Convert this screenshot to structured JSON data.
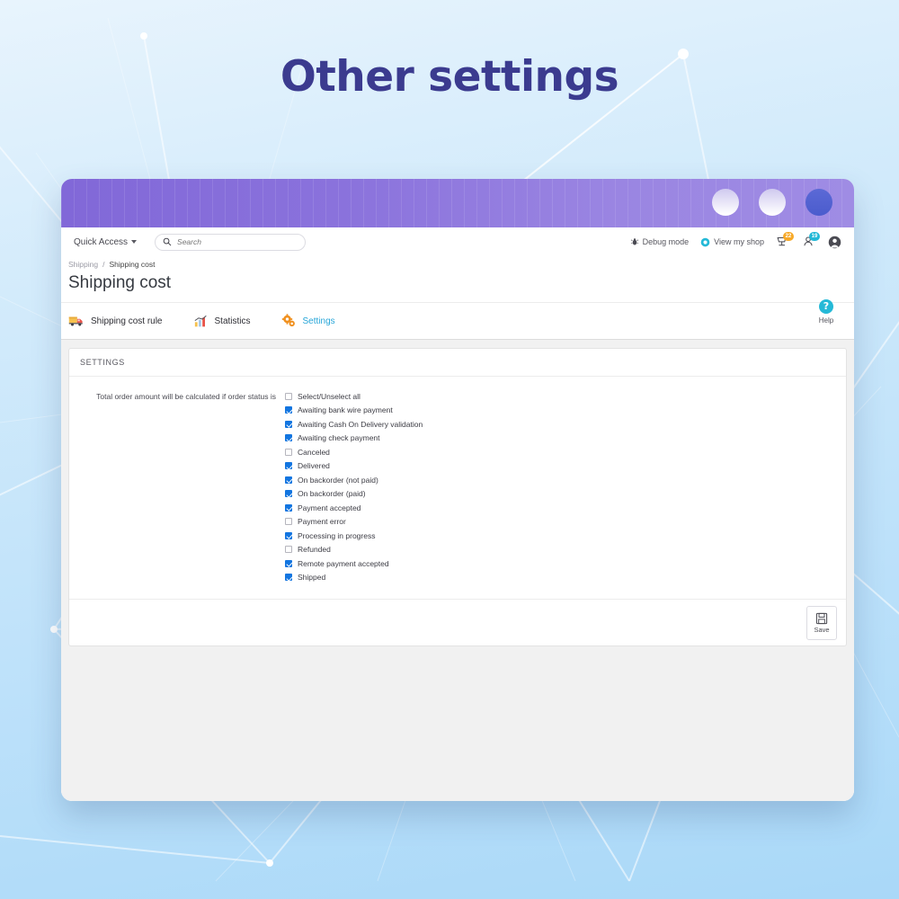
{
  "hero": {
    "title": "Other settings"
  },
  "window": {
    "controls": [
      {
        "name": "window-circle-1",
        "style": "light"
      },
      {
        "name": "window-circle-2",
        "style": "light"
      },
      {
        "name": "window-circle-3",
        "style": "dark"
      }
    ]
  },
  "header": {
    "quick_access": "Quick Access",
    "search": {
      "placeholder": "Search",
      "value": ""
    },
    "tools": [
      {
        "icon": "bug-icon",
        "label": "Debug mode"
      },
      {
        "icon": "eye-icon",
        "label": "View my shop"
      }
    ],
    "badges": [
      {
        "icon": "cart-icon",
        "count": "22",
        "color": "#f7a928"
      },
      {
        "icon": "customer-icon",
        "count": "19",
        "color": "#25b9d7"
      }
    ],
    "account": "account-icon"
  },
  "breadcrumb": {
    "parent": "Shipping",
    "separator": "/",
    "current": "Shipping cost"
  },
  "page": {
    "title": "Shipping cost"
  },
  "help": {
    "glyph": "?",
    "label": "Help"
  },
  "tabs": [
    {
      "label": "Shipping cost rule",
      "icon": "truck-icon",
      "active": false
    },
    {
      "label": "Statistics",
      "icon": "bar-chart-icon",
      "active": false
    },
    {
      "label": "Settings",
      "icon": "gears-icon",
      "active": true
    }
  ],
  "panel": {
    "header": "SETTINGS",
    "form_label": "Total order amount will be calculated if order status is",
    "options": [
      {
        "label": "Select/Unselect all",
        "checked": false
      },
      {
        "label": "Awaiting bank wire payment",
        "checked": true
      },
      {
        "label": "Awaiting Cash On Delivery validation",
        "checked": true
      },
      {
        "label": "Awaiting check payment",
        "checked": true
      },
      {
        "label": "Canceled",
        "checked": false
      },
      {
        "label": "Delivered",
        "checked": true
      },
      {
        "label": "On backorder (not paid)",
        "checked": true
      },
      {
        "label": "On backorder (paid)",
        "checked": true
      },
      {
        "label": "Payment accepted",
        "checked": true
      },
      {
        "label": "Payment error",
        "checked": false
      },
      {
        "label": "Processing in progress",
        "checked": true
      },
      {
        "label": "Refunded",
        "checked": false
      },
      {
        "label": "Remote payment accepted",
        "checked": true
      },
      {
        "label": "Shipped",
        "checked": true
      }
    ],
    "save": {
      "label": "Save",
      "icon": "floppy-disk-icon"
    }
  },
  "colors": {
    "accent_blue": "#25a5d8",
    "checkbox_blue": "#1275e0",
    "chrome_purple": "#8a72dc",
    "title_indigo": "#3b3b8f",
    "badge_orange": "#f7a928"
  }
}
